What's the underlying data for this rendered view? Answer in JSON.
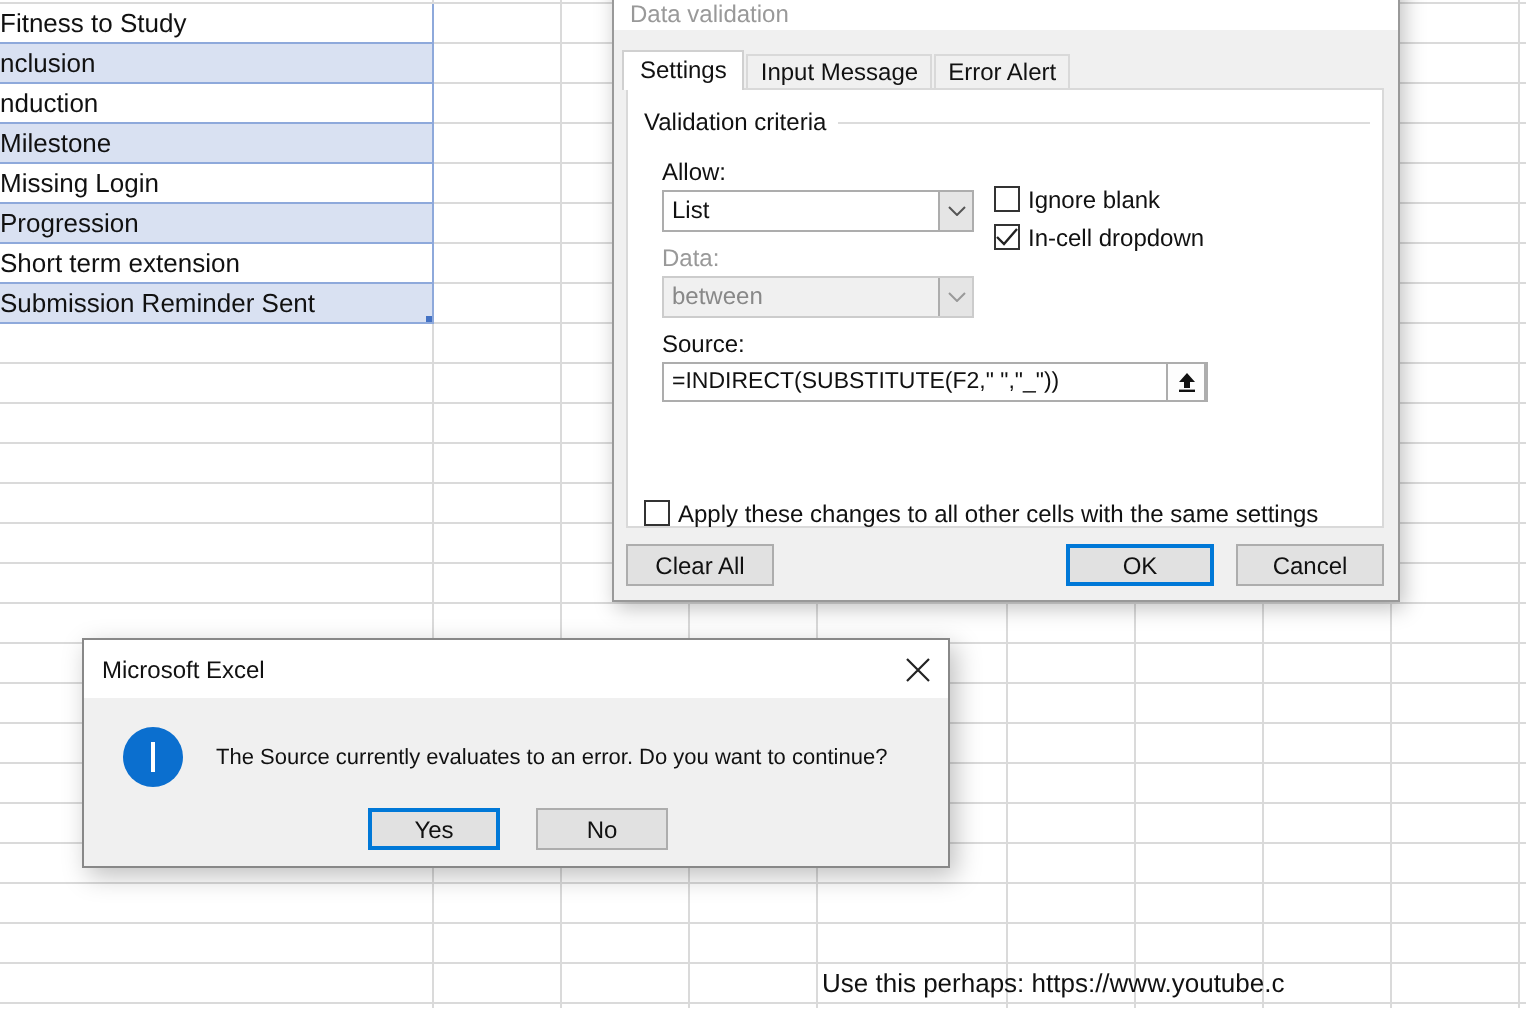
{
  "sheet": {
    "list_rows": [
      {
        "text": "Fitness to Study",
        "shaded": false
      },
      {
        "text": "nclusion",
        "shaded": true
      },
      {
        "text": "nduction",
        "shaded": false
      },
      {
        "text": "Milestone",
        "shaded": true
      },
      {
        "text": "Missing Login",
        "shaded": false
      },
      {
        "text": "Progression",
        "shaded": true
      },
      {
        "text": "Short term extension",
        "shaded": false
      },
      {
        "text": "Submission Reminder Sent",
        "shaded": true
      }
    ],
    "note": "Use this perhaps: https://www.youtube.c"
  },
  "data_validation": {
    "title": "Data validation",
    "tabs": [
      {
        "label": "Settings",
        "selected": true
      },
      {
        "label": "Input Message",
        "selected": false
      },
      {
        "label": "Error Alert",
        "selected": false
      }
    ],
    "group_label": "Validation criteria",
    "allow": {
      "label": "Allow:",
      "value": "List",
      "disabled": false
    },
    "ignore_blank": {
      "label": "Ignore blank",
      "checked": false
    },
    "in_cell_dropdown": {
      "label": "In-cell dropdown",
      "checked": true
    },
    "data": {
      "label": "Data:",
      "value": "between",
      "disabled": true
    },
    "source": {
      "label": "Source:",
      "value": "=INDIRECT(SUBSTITUTE(F2,\" \",\"_\"))"
    },
    "apply_all": {
      "label": "Apply these changes to all other cells with the same settings",
      "checked": false
    },
    "buttons": [
      {
        "label": "Clear All",
        "default": false
      },
      {
        "label": "OK",
        "default": true
      },
      {
        "label": "Cancel",
        "default": false
      }
    ]
  },
  "message_box": {
    "title": "Microsoft Excel",
    "message": "The Source currently evaluates to an error. Do you want to continue?",
    "buttons": [
      {
        "label": "Yes",
        "default": true
      },
      {
        "label": "No",
        "default": false
      }
    ]
  }
}
